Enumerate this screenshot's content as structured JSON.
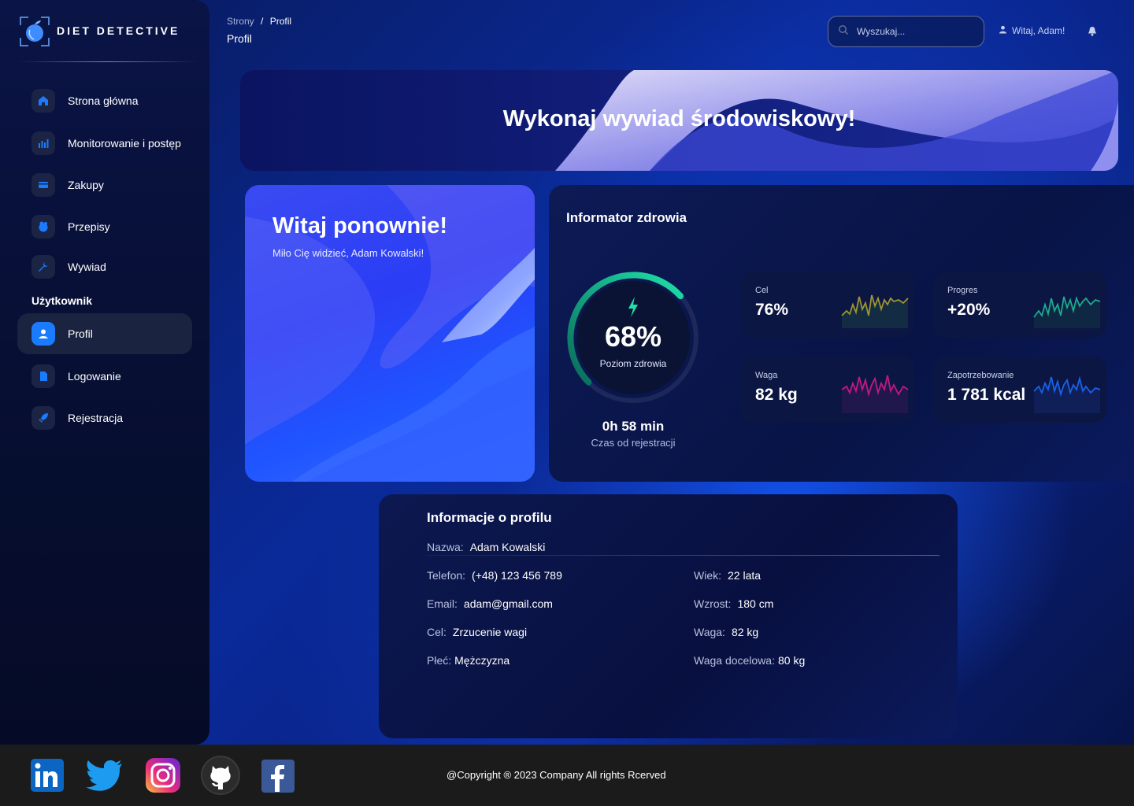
{
  "brand": {
    "name": "DIET DETECTIVE"
  },
  "sidebar": {
    "items": [
      {
        "label": "Strona główna",
        "icon": "home-icon"
      },
      {
        "label": "Monitorowanie i postęp",
        "icon": "chart-icon"
      },
      {
        "label": "Zakupy",
        "icon": "credit-card-icon"
      },
      {
        "label": "Przepisy",
        "icon": "recipes-icon"
      },
      {
        "label": "Wywiad",
        "icon": "wrench-icon"
      }
    ],
    "section_label": "Użytkownik",
    "user_items": [
      {
        "label": "Profil",
        "icon": "user-icon",
        "active": true
      },
      {
        "label": "Logowanie",
        "icon": "document-icon"
      },
      {
        "label": "Rejestracja",
        "icon": "rocket-icon"
      }
    ]
  },
  "header": {
    "breadcrumb_root": "Strony",
    "breadcrumb_sep": "/",
    "breadcrumb_current": "Profil",
    "title": "Profil",
    "search_placeholder": "Wyszukaj...",
    "user_greeting": "Witaj, Adam!"
  },
  "banner": {
    "title": "Wykonaj wywiad środowiskowy!"
  },
  "welcome": {
    "title": "Witaj ponownie!",
    "subtitle": "Miło Cię widzieć, Adam Kowalski!"
  },
  "health": {
    "title": "Informator zdrowia",
    "gauge_value": "68%",
    "gauge_fraction": 0.68,
    "gauge_label": "Poziom zdrowia",
    "since_value": "0h 58 min",
    "since_label": "Czas od rejestracji",
    "stats": [
      {
        "label": "Cel",
        "value": "76%",
        "color": "#c8b52a"
      },
      {
        "label": "Progres",
        "value": "+20%",
        "color": "#1fc8a0"
      },
      {
        "label": "Waga",
        "value": "82 kg",
        "color": "#e8188f"
      },
      {
        "label": "Zapotrzebowanie",
        "value": "1 781 kcal",
        "color": "#1a6bff"
      }
    ]
  },
  "profile": {
    "title": "Informacje o profilu",
    "name_key": "Nazwa:",
    "name_val": "Adam Kowalski",
    "phone_key": "Telefon:",
    "phone_val": "(+48) 123 456 789",
    "email_key": "Email:",
    "email_val": "adam@gmail.com",
    "goal_key": "Cel:",
    "goal_val": "Zrzucenie wagi",
    "sex_key": "Płeć:",
    "sex_val": "Mężczyzna",
    "age_key": "Wiek:",
    "age_val": "22 lata",
    "height_key": "Wzrost:",
    "height_val": "180 cm",
    "weight_key": "Waga:",
    "weight_val": "82 kg",
    "target_key": "Waga docelowa:",
    "target_val": "80 kg"
  },
  "footer": {
    "copyright": "@Copyright ® 2023 Company All rights Rcerved",
    "social": [
      "linkedin-icon",
      "twitter-icon",
      "instagram-icon",
      "github-icon",
      "facebook-icon"
    ]
  }
}
